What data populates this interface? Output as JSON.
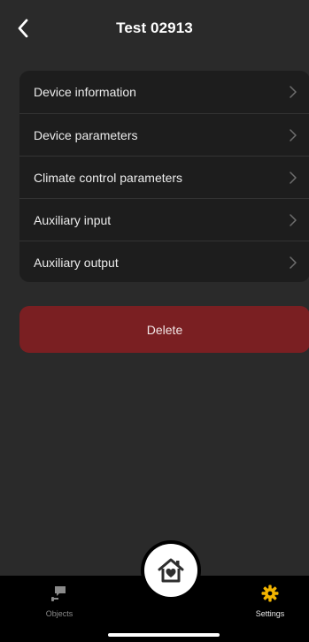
{
  "header": {
    "title": "Test 02913",
    "back_icon": "chevron-left-icon"
  },
  "menu": {
    "items": [
      {
        "label": "Device information",
        "icon": "chevron-right-icon"
      },
      {
        "label": "Device parameters",
        "icon": "chevron-right-icon"
      },
      {
        "label": "Climate control parameters",
        "icon": "chevron-right-icon"
      },
      {
        "label": "Auxiliary input",
        "icon": "chevron-right-icon"
      },
      {
        "label": "Auxiliary output",
        "icon": "chevron-right-icon"
      }
    ]
  },
  "actions": {
    "delete_label": "Delete"
  },
  "tabbar": {
    "objects_label": "Objects",
    "objects_icon": "camera-icon",
    "settings_label": "Settings",
    "settings_icon": "gear-icon",
    "home_icon": "home-heart-icon"
  },
  "colors": {
    "background": "#2a2a2a",
    "card": "#1d1d1d",
    "delete": "#7a1f22",
    "settings_accent": "#f2b400",
    "tabbar": "#000000"
  }
}
